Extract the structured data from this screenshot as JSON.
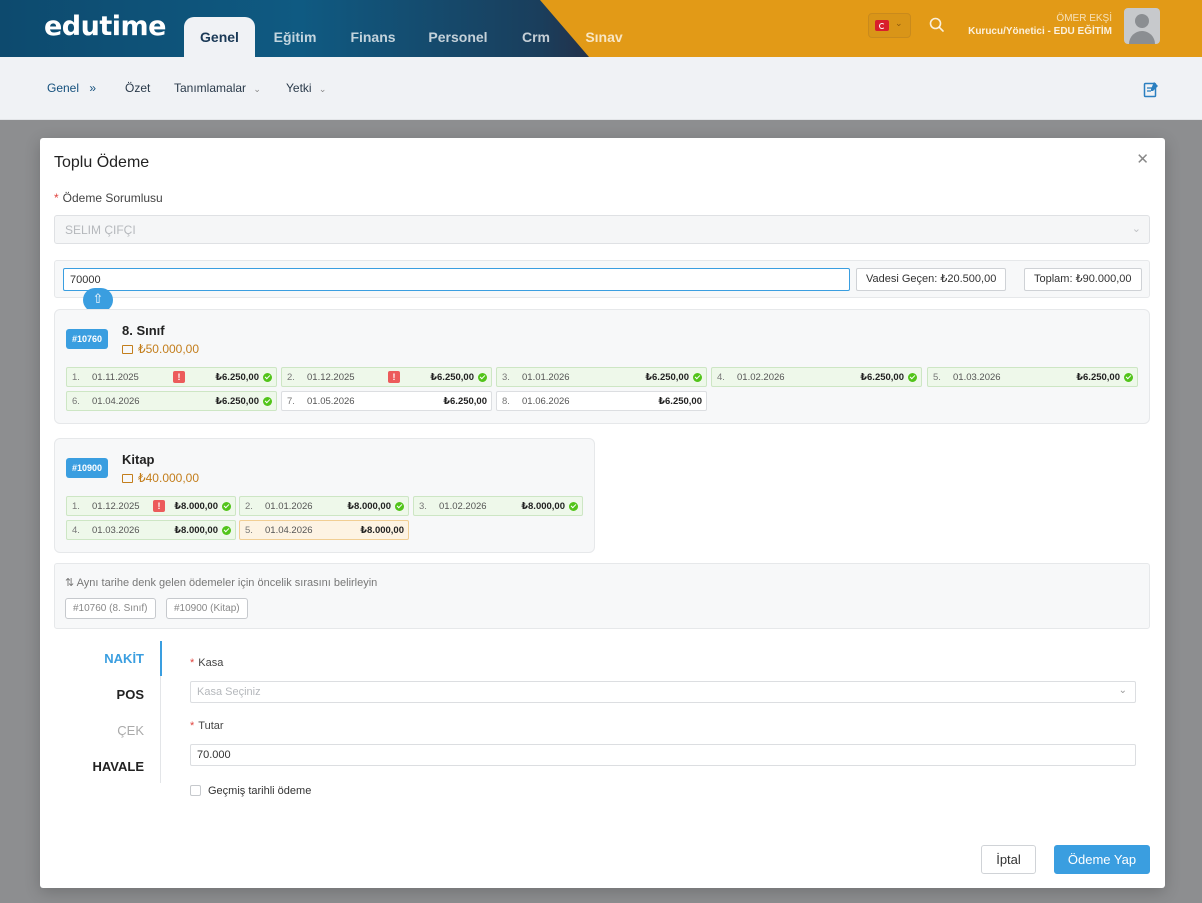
{
  "brand": {
    "logo_text": "edutime"
  },
  "topnav": {
    "tabs": [
      "Genel",
      "Eğitim",
      "Finans",
      "Personel",
      "Crm",
      "Sınav"
    ],
    "active": "Genel"
  },
  "user": {
    "name": "ÖMER EKŞİ",
    "role": "Kurucu/Yönetici - EDU EĞİTİM"
  },
  "colors": {
    "accent": "#3a9ee0",
    "topbar": "#0f5a82",
    "topbar_right": "#e29a17",
    "success": "#52c41a",
    "warning": "#ec5b5b",
    "amount": "#c37e1c"
  },
  "breadcrumb": {
    "items": [
      {
        "label": "Genel",
        "icon": "double-chevron-right-icon"
      },
      {
        "label": "Özet"
      },
      {
        "label": "Tanımlamalar",
        "icon": "chevron-down-icon"
      },
      {
        "label": "Yetki",
        "icon": "chevron-down-icon"
      }
    ]
  },
  "modal": {
    "title": "Toplu Ödeme",
    "payer_label": "Ödeme Sorumlusu",
    "payer_value": "SELIM ÇIFÇI",
    "amount_value": "70000",
    "overdue_chip": "Vadesi Geçen: ₺20.500,00",
    "total_chip": "Toplam: ₺90.000,00",
    "cards": [
      {
        "id": "#10760",
        "title": "8. Sınıf",
        "total": "₺50.000,00",
        "installments": [
          {
            "no": "1.",
            "date": "01.11.2025",
            "amount": "₺6.250,00",
            "overdue": true,
            "paid": true
          },
          {
            "no": "2.",
            "date": "01.12.2025",
            "amount": "₺6.250,00",
            "overdue": true,
            "paid": true
          },
          {
            "no": "3.",
            "date": "01.01.2026",
            "amount": "₺6.250,00",
            "paid": true
          },
          {
            "no": "4.",
            "date": "01.02.2026",
            "amount": "₺6.250,00",
            "paid": true
          },
          {
            "no": "5.",
            "date": "01.03.2026",
            "amount": "₺6.250,00",
            "paid": true
          },
          {
            "no": "6.",
            "date": "01.04.2026",
            "amount": "₺6.250,00",
            "paid": true
          },
          {
            "no": "7.",
            "date": "01.05.2026",
            "amount": "₺6.250,00"
          },
          {
            "no": "8.",
            "date": "01.06.2026",
            "amount": "₺6.250,00"
          }
        ]
      },
      {
        "id": "#10900",
        "title": "Kitap",
        "total": "₺40.000,00",
        "installments": [
          {
            "no": "1.",
            "date": "01.12.2025",
            "amount": "₺8.000,00",
            "overdue": true,
            "paid": true
          },
          {
            "no": "2.",
            "date": "01.01.2026",
            "amount": "₺8.000,00",
            "paid": true
          },
          {
            "no": "3.",
            "date": "01.02.2026",
            "amount": "₺8.000,00",
            "paid": true
          },
          {
            "no": "4.",
            "date": "01.03.2026",
            "amount": "₺8.000,00",
            "paid": true
          },
          {
            "no": "5.",
            "date": "01.04.2026",
            "amount": "₺8.000,00",
            "partial": true
          }
        ]
      }
    ],
    "priority_text": "Aynı tarihe denk gelen ödemeler için öncelik sırasını belirleyin",
    "priority_tags": [
      "#10760 (8. Sınıf)",
      "#10900 (Kitap)"
    ],
    "payment_tabs": [
      {
        "label": "NAKİT",
        "state": "active"
      },
      {
        "label": "POS"
      },
      {
        "label": "ÇEK",
        "state": "disabled"
      },
      {
        "label": "HAVALE"
      }
    ],
    "kasa_label": "Kasa",
    "kasa_placeholder": "Kasa Seçiniz",
    "tutar_label": "Tutar",
    "tutar_value": "70.000",
    "past_date_label": "Geçmiş tarihli ödeme",
    "cancel_label": "İptal",
    "submit_label": "Ödeme Yap"
  }
}
